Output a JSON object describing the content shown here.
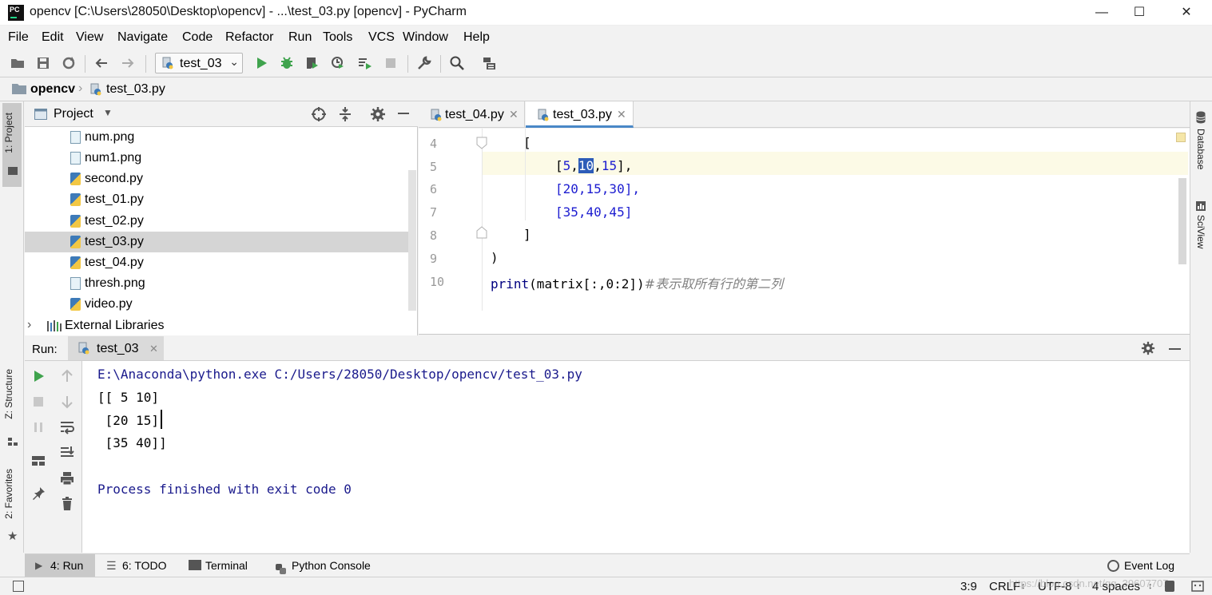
{
  "window": {
    "title": "opencv [C:\\Users\\28050\\Desktop\\opencv] - ...\\test_03.py [opencv] - PyCharm",
    "logo_text": "PC",
    "minimize_icon": "minimize-icon",
    "maximize_icon": "maximize-icon",
    "close_icon": "close-icon"
  },
  "menu": [
    "File",
    "Edit",
    "View",
    "Navigate",
    "Code",
    "Refactor",
    "Run",
    "Tools",
    "VCS",
    "Window",
    "Help"
  ],
  "toolbar": {
    "run_config": "test_03"
  },
  "breadcrumb": {
    "project": "opencv",
    "file": "test_03.py"
  },
  "left_strip": {
    "project_tab": "1: Project",
    "structure_tab": "Z: Structure",
    "favorites_tab": "2: Favorites"
  },
  "right_strip": {
    "database_tab": "Database",
    "sciview_tab": "SciView"
  },
  "project_panel": {
    "title": "Project",
    "files": [
      {
        "name": "num.png",
        "type": "png"
      },
      {
        "name": "num1.png",
        "type": "png"
      },
      {
        "name": "second.py",
        "type": "py"
      },
      {
        "name": "test_01.py",
        "type": "py"
      },
      {
        "name": "test_02.py",
        "type": "py"
      },
      {
        "name": "test_03.py",
        "type": "py",
        "selected": true
      },
      {
        "name": "test_04.py",
        "type": "py"
      },
      {
        "name": "thresh.png",
        "type": "png"
      },
      {
        "name": "video.py",
        "type": "py"
      }
    ],
    "external_libraries": "External Libraries"
  },
  "editor": {
    "tabs": [
      {
        "label": "test_04.py",
        "active": false
      },
      {
        "label": "test_03.py",
        "active": true
      }
    ],
    "line_numbers": [
      "4",
      "5",
      "6",
      "7",
      "8",
      "9",
      "10"
    ],
    "lines": {
      "l4": "[",
      "l5_open": "[",
      "l5_a": "5",
      "l5_comma1": ",",
      "l5_sel": "10",
      "l5_comma2": ",",
      "l5_c": "15",
      "l5_close": "],",
      "l6": "[20,15,30],",
      "l7": "[35,40,45]",
      "l8": "]",
      "l9": ")",
      "l10_fn": "print",
      "l10_args": "(matrix[:,0:2])",
      "l10_comment": "#表示取所有行的第二列"
    }
  },
  "run_panel": {
    "label": "Run:",
    "tab": "test_03",
    "output": [
      "E:\\Anaconda\\python.exe C:/Users/28050/Desktop/opencv/test_03.py",
      "[[ 5 10]",
      " [20 15]",
      " [35 40]]",
      "",
      "Process finished with exit code 0"
    ]
  },
  "bottom_tabs": {
    "run": "4: Run",
    "todo": "6: TODO",
    "terminal": "Terminal",
    "python_console": "Python Console",
    "event_log": "Event Log"
  },
  "status": {
    "position": "3:9",
    "line_sep": "CRLF",
    "encoding": "UTF-8",
    "indent": "4 spaces",
    "watermark": "https://blog.csdn.net/qq_39607707"
  },
  "colors": {
    "accent_green": "#3fa34d",
    "selection": "#2d5cb8",
    "number_blue": "#1c1cd0"
  }
}
